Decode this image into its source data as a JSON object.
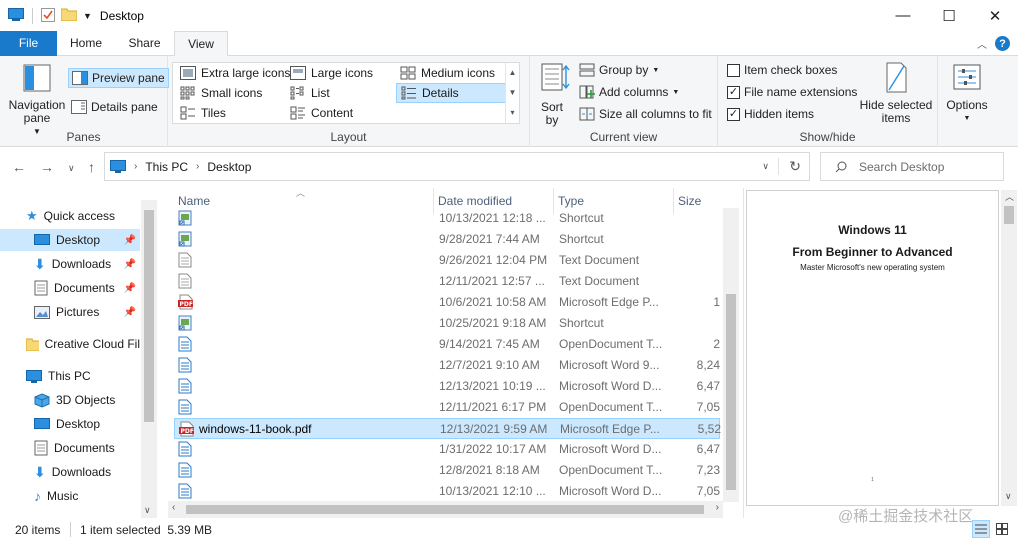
{
  "window": {
    "title": "Desktop",
    "minimize": "—",
    "maximize": "☐",
    "close": "✕"
  },
  "tabs": [
    {
      "label": "File"
    },
    {
      "label": "Home"
    },
    {
      "label": "Share"
    },
    {
      "label": "View"
    }
  ],
  "ribbon": {
    "panes": {
      "label": "Panes",
      "navigation_pane": "Navigation pane",
      "preview_pane": "Preview pane",
      "details_pane": "Details pane"
    },
    "layout": {
      "label": "Layout",
      "items": [
        "Extra large icons",
        "Large icons",
        "Medium icons",
        "Small icons",
        "List",
        "Details",
        "Tiles",
        "Content"
      ],
      "selected": "Details"
    },
    "current_view": {
      "label": "Current view",
      "sort_by": "Sort by",
      "group_by": "Group by",
      "add_columns": "Add columns",
      "size_all_columns": "Size all columns to fit"
    },
    "show_hide": {
      "label": "Show/hide",
      "item_check_boxes": "Item check boxes",
      "item_check_boxes_checked": false,
      "file_name_extensions": "File name extensions",
      "file_name_extensions_checked": true,
      "hidden_items": "Hidden items",
      "hidden_items_checked": true,
      "hide_selected_items": "Hide selected items"
    },
    "options": "Options"
  },
  "address": {
    "crumbs": [
      "This PC",
      "Desktop"
    ],
    "search_placeholder": "Search Desktop"
  },
  "nav": {
    "quick_access": "Quick access",
    "quick_items": [
      "Desktop",
      "Downloads",
      "Documents",
      "Pictures"
    ],
    "creative_cloud": "Creative Cloud Fil",
    "this_pc": "This PC",
    "pc_items": [
      "3D Objects",
      "Desktop",
      "Documents",
      "Downloads",
      "Music"
    ]
  },
  "columns": {
    "name": "Name",
    "date": "Date modified",
    "type": "Type",
    "size": "Size"
  },
  "files": [
    {
      "name": "",
      "date": "10/13/2021 12:18 ...",
      "type": "Shortcut",
      "size": "",
      "icon": "shortcut-icon"
    },
    {
      "name": "",
      "date": "9/28/2021 7:44 AM",
      "type": "Shortcut",
      "size": "",
      "icon": "shortcut-icon"
    },
    {
      "name": "",
      "date": "9/26/2021 12:04 PM",
      "type": "Text Document",
      "size": "",
      "icon": "text-file-icon"
    },
    {
      "name": "",
      "date": "12/11/2021 12:57 ...",
      "type": "Text Document",
      "size": "",
      "icon": "text-file-icon"
    },
    {
      "name": "",
      "date": "10/6/2021 10:58 AM",
      "type": "Microsoft Edge P...",
      "size": "1",
      "icon": "pdf-icon"
    },
    {
      "name": "",
      "date": "10/25/2021 9:18 AM",
      "type": "Shortcut",
      "size": "",
      "icon": "shortcut-icon"
    },
    {
      "name": "",
      "date": "9/14/2021 7:45 AM",
      "type": "OpenDocument T...",
      "size": "2",
      "icon": "document-icon"
    },
    {
      "name": "",
      "date": "12/7/2021 9:10 AM",
      "type": "Microsoft Word 9...",
      "size": "8,24",
      "icon": "document-icon"
    },
    {
      "name": "",
      "date": "12/13/2021 10:19 ...",
      "type": "Microsoft Word D...",
      "size": "6,47",
      "icon": "document-icon"
    },
    {
      "name": "",
      "date": "12/11/2021 6:17 PM",
      "type": "OpenDocument T...",
      "size": "7,05",
      "icon": "document-icon"
    },
    {
      "name": "windows-11-book.pdf",
      "date": "12/13/2021 9:59 AM",
      "type": "Microsoft Edge P...",
      "size": "5,52",
      "icon": "pdf-icon",
      "selected": true
    },
    {
      "name": "",
      "date": "1/31/2022 10:17 AM",
      "type": "Microsoft Word D...",
      "size": "6,47",
      "icon": "document-icon"
    },
    {
      "name": "",
      "date": "12/8/2021 8:18 AM",
      "type": "OpenDocument T...",
      "size": "7,23",
      "icon": "document-icon"
    },
    {
      "name": "",
      "date": "10/13/2021 12:10 ...",
      "type": "Microsoft Word D...",
      "size": "7,05",
      "icon": "document-icon"
    }
  ],
  "preview": {
    "title": "Windows 11",
    "subtitle": "From Beginner to Advanced",
    "tagline": "Master Microsoft's new operating system",
    "page_mark": "1"
  },
  "status": {
    "item_count": "20 items",
    "selection": "1 item selected  5.39 MB"
  },
  "watermark": "@稀土掘金技术社区",
  "colors": {
    "accent": "#1979ca",
    "selection": "#cce8ff",
    "selection_border": "#99d1ff"
  }
}
